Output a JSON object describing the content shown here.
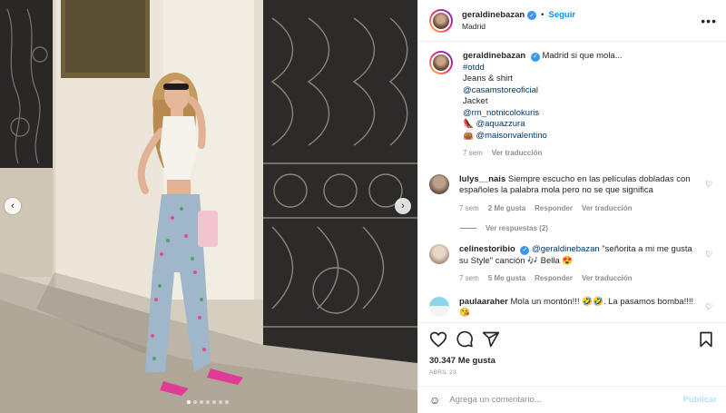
{
  "post": {
    "username": "geraldinebazan",
    "follow_label": "Seguir",
    "location": "Madrid",
    "more_label": "•••",
    "caption": {
      "text": "Madrid si que mola...",
      "hashtag": "#otdd",
      "line1": "Jeans & shirt",
      "mention1": "@casamstoreoficial",
      "line2": "Jacket",
      "mention2": "@rm_notnicolokuris",
      "emoji3": "👠",
      "mention3": "@aquazzura",
      "emoji4": "👜",
      "mention4": "@maisonvalentino",
      "time": "7 sem",
      "translate": "Ver traducción"
    },
    "comments": [
      {
        "user": "lulys__nais",
        "text": "Siempre escucho en las películas dobladas con españoles la palabra mola pero no se que significa",
        "time": "7 sem",
        "likes": "2 Me gusta",
        "reply": "Responder",
        "translate": "Ver traducción",
        "view_replies": "Ver respuestas (2)"
      },
      {
        "user": "celinestoribio",
        "mention": "@geraldinebazan",
        "text": "\"señorita a mi me gusta su Style\" canción 🎶 Bella 😍",
        "time": "7 sem",
        "likes": "5 Me gusta",
        "reply": "Responder",
        "translate": "Ver traducción"
      },
      {
        "user": "paulaaraher",
        "text": "Mola un montón!!! 🤣🤣. La pasamos bomba!!!! 😘"
      }
    ],
    "likes_count": "30.347 Me gusta",
    "date": "ABRIL 23",
    "comment_placeholder": "Agrega un comentario...",
    "publish_label": "Publicar"
  },
  "icons": {
    "verified": "verified-badge-icon",
    "heart": "heart-icon",
    "comment": "comment-icon",
    "share": "share-icon",
    "save": "bookmark-icon",
    "emoji": "emoji-icon",
    "prev": "chevron-left-icon",
    "next": "chevron-right-icon"
  },
  "colors": {
    "link_blue": "#0095f6",
    "mention": "#00376b",
    "muted": "#8e8e8e",
    "publish_disabled": "#b2dffc"
  },
  "carousel": {
    "count": 7,
    "active": 1,
    "prev": "‹",
    "next": "›"
  }
}
